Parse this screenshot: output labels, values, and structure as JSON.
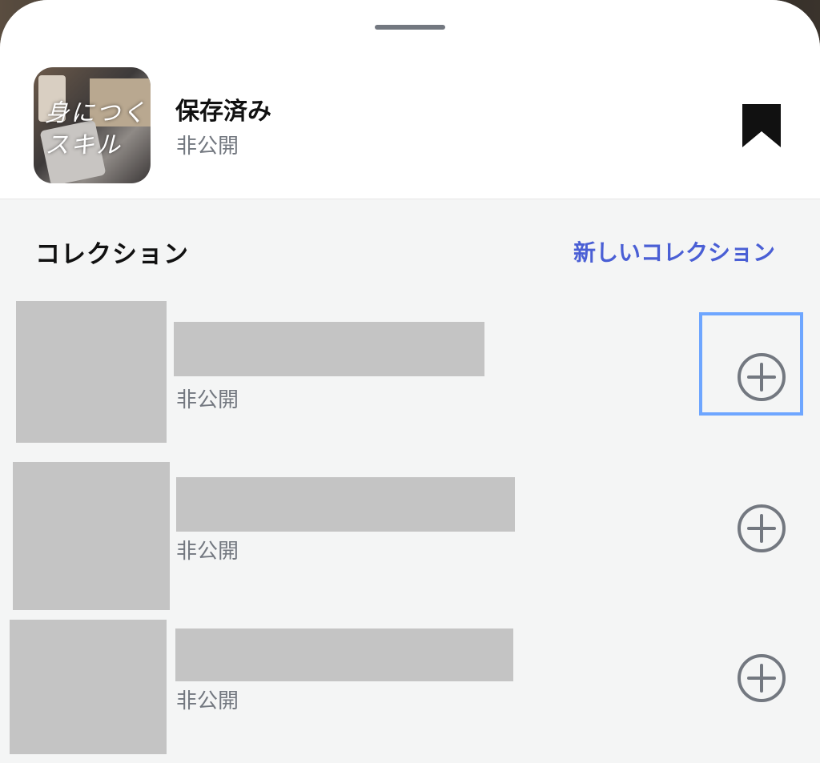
{
  "saved": {
    "title": "保存済み",
    "privacy": "非公開",
    "cover_text": "身につく\nスキル",
    "bookmark_icon": "bookmark-filled-icon"
  },
  "collections": {
    "section_title": "コレクション",
    "new_collection_label": "新しいコレクション",
    "items": [
      {
        "privacy": "非公開",
        "add_icon": "plus-circle-icon"
      },
      {
        "privacy": "非公開",
        "add_icon": "plus-circle-icon"
      },
      {
        "privacy": "非公開",
        "add_icon": "plus-circle-icon"
      }
    ]
  },
  "colors": {
    "accent": "#4a5fd5",
    "secondary_text": "#737880",
    "placeholder": "#c4c4c4",
    "focus": "#6ea6ff"
  }
}
